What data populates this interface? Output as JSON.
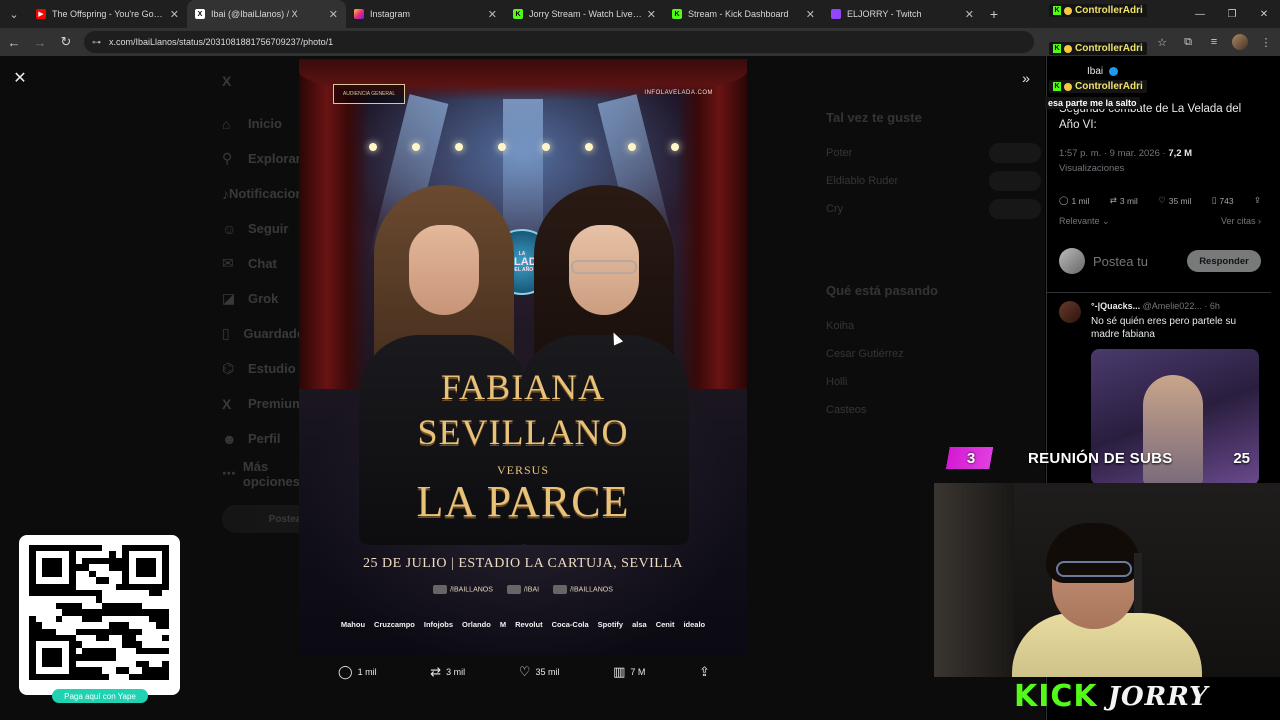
{
  "browser": {
    "tabs": [
      {
        "title": "The Offspring - You're Gonna G",
        "icon": "youtube-icon",
        "color": "#ff0000",
        "active": false
      },
      {
        "title": "Ibai (@IbaiLlanos) / X",
        "icon": "x-icon",
        "color": "#ffffff",
        "active": true
      },
      {
        "title": "Instagram",
        "icon": "instagram-icon",
        "color": "#e1306c",
        "active": false
      },
      {
        "title": "Jorry Stream - Watch Live on Ki",
        "icon": "kick-icon",
        "color": "#53fc18",
        "active": false
      },
      {
        "title": "Stream - Kick Dashboard",
        "icon": "kick-icon",
        "color": "#53fc18",
        "active": false
      },
      {
        "title": "ELJORRY - Twitch",
        "icon": "twitch-icon",
        "color": "#9146ff",
        "active": false
      }
    ],
    "url": "x.com/IbaiLlanos/status/2031081881756709237/photo/1"
  },
  "x_background": {
    "sidebar": [
      "Inicio",
      "Explorar",
      "Notificaciones",
      "Seguir",
      "Chat",
      "Grok",
      "Guardados",
      "Estudio",
      "Premium",
      "Perfil",
      "Más opciones"
    ],
    "post_label": "Postear",
    "right_heading_1": "Tal vez te guste",
    "suggestions": [
      "Poter",
      "Eldiablo Ruder",
      "Cry"
    ],
    "right_heading_2": "Qué está pasando",
    "trends": [
      "Koiha",
      "Cesar Gutiérrez",
      "Holli",
      "Casteos"
    ]
  },
  "poster": {
    "logo_text": "AUDIENCIA GENERAL",
    "url_text": "INFOLAVELADA.COM",
    "badge_top": "LA",
    "badge_main": "VELADA",
    "badge_bottom": "DEL AÑO",
    "fighter_1": "FABIANA",
    "fighter_1b": "SEVILLANO",
    "versus": "VERSUS",
    "fighter_2": "LA PARCE",
    "date_venue": "25 DE JULIO | ESTADIO LA CARTUJA, SEVILLA",
    "socials": [
      "/IBAILLANOS",
      "/IBAI",
      "/IBAILLANOS"
    ],
    "sponsors": [
      "Mahou",
      "Cruzcampo",
      "Infojobs",
      "Orlando",
      "M",
      "Revolut",
      "Coca-Cola",
      "Spotify",
      "alsa",
      "Cenit",
      "idealo"
    ]
  },
  "media_bar": {
    "replies": "1 mil",
    "reposts": "3 mil",
    "likes": "35 mil",
    "views": "7 M"
  },
  "tweet": {
    "author": "Ibai",
    "text": "Segundo combate de La Velada del Año VI:",
    "time": "1:57 p. m. · 9 mar. 2026 ·",
    "views_count": "7,2 M",
    "views_label": "Visualizaciones",
    "replies": "1 mil",
    "reposts": "3 mil",
    "likes": "35 mil",
    "bookmarks": "743",
    "sort_label": "Relevante",
    "quotes_label": "Ver citas",
    "reply_placeholder": "Postea tu",
    "reply_button": "Responder"
  },
  "reply": {
    "name": "°-|Quacks...",
    "handle": "@Amelie022...",
    "time": "· 6h",
    "text": "No sé quién eres pero partele su madre fabiana"
  },
  "stream": {
    "chat_user": "ControllerAdri",
    "chat_message": "esa parte me la salto",
    "subs_left": "3",
    "subs_label": "REUNIÓN DE SUBS",
    "subs_right": "25",
    "brand_1": "KICK",
    "brand_2": "JORRY",
    "qr_caption": "Paga aquí con Yape",
    "accent_kick": "#53fc18",
    "accent_subs": "#d41ad4"
  }
}
